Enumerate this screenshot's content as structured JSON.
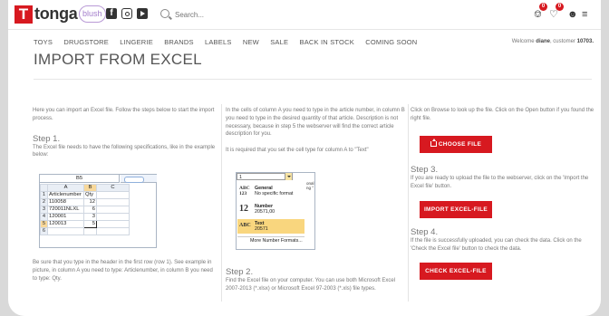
{
  "header": {
    "logo_letter": "T",
    "logo_text": "tonga",
    "blush_label": "blush",
    "search_placeholder": "Search...",
    "cart_badge": "0",
    "wishlist_badge": "0",
    "icons": [
      "facebook-icon",
      "instagram-icon",
      "youtube-icon",
      "search-icon",
      "cart-icon",
      "heart-icon",
      "user-icon",
      "settings-icon"
    ]
  },
  "nav": {
    "items": [
      "TOYS",
      "DRUGSTORE",
      "LINGERIE",
      "BRANDS",
      "LABELS",
      "NEW",
      "SALE",
      "BACK IN STOCK",
      "COMING SOON"
    ],
    "welcome_prefix": "Welcome",
    "welcome_name": "diane",
    "welcome_mid": ", customer",
    "customer_no": "10703."
  },
  "page": {
    "title": "IMPORT FROM EXCEL"
  },
  "col1": {
    "intro": "Here you can import an Excel file. Follow the steps below to start the import process.",
    "step1_title": "Step 1.",
    "step1_text": "The Excel file needs to have the following specifications, like in the example below:",
    "excel": {
      "namebox": "B5",
      "columns": [
        "",
        "A",
        "B",
        "C"
      ],
      "rows": [
        [
          "1",
          "Articlenumber",
          "Qty",
          ""
        ],
        [
          "2",
          "110058",
          "12",
          ""
        ],
        [
          "3",
          "720011NLXL",
          "6",
          ""
        ],
        [
          "4",
          "120001",
          "3",
          ""
        ],
        [
          "5",
          "120013",
          "5",
          ""
        ],
        [
          "6",
          "",
          "",
          ""
        ]
      ]
    },
    "footer": "Be sure that you type in the header in the first row (row 1). See example in picture, in column A you need to type: Articlenumber, in column B you need to type: Qty."
  },
  "col2": {
    "text1": "In the cells of column A you need to type in the article number, in column B you need to type in the desired quantity of that article. Description is not necessary, because in step 5 the webserver will find the correct article description for you.",
    "text2": "It is required that you set the cell type for column A to \"Text\"",
    "format": {
      "top_value": "1",
      "side_text": "onal ng °",
      "options": [
        {
          "icon": "ABC 123",
          "title": "General",
          "sub": "No specific format"
        },
        {
          "icon": "12",
          "title": "Number",
          "sub": "20571,00"
        },
        {
          "icon": "ABC",
          "title": "Text",
          "sub": "20571"
        }
      ],
      "more": "More Number Formats..."
    },
    "step2_title": "Step 2.",
    "step2_text": "Find the Excel file on your computer. You can use both Microsoft Excel 2007-2013 (*.xlsx) or Microsoft Excel 97-2003 (*.xls) file types."
  },
  "col3": {
    "text1": "Click on Browse to look up the file. Click on the Open button if you found the right file.",
    "choose_label": "CHOOSE FILE",
    "step3_title": "Step 3.",
    "step3_text": "If you are ready to upload the file to the webserver, click on the 'Import the Excel file' button.",
    "import_label": "IMPORT EXCEL-FILE",
    "step4_title": "Step 4.",
    "step4_text": "If the file is successfully uploaded, you can check the data. Click on the 'Check the Excel file' button to check the data.",
    "check_label": "CHECK EXCEL-FILE"
  },
  "colors": {
    "accent": "#d71920",
    "blush": "#a47fcc",
    "text": "#777777"
  }
}
